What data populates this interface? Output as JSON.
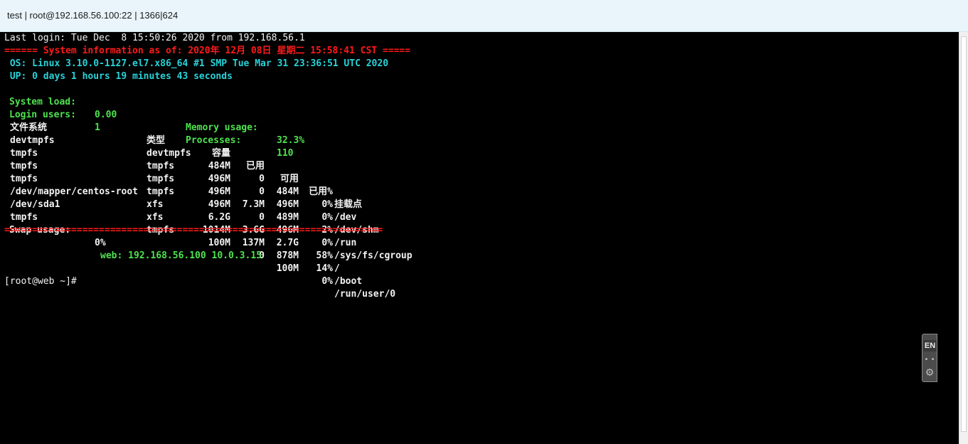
{
  "window": {
    "title": "test | root@192.168.56.100:22 | 1366|624"
  },
  "terminal": {
    "last_login": "Last login: Tue Dec  8 15:50:26 2020 from 192.168.56.1",
    "sysinfo_header": "====== System information as of: 2020年 12月 08日 星期二 15:58:41 CST =====",
    "os_line": " OS: Linux 3.10.0-1127.el7.x86_64 #1 SMP Tue Mar 31 23:36:51 UTC 2020",
    "up_line": " UP: 0 days 1 hours 19 minutes 43 seconds",
    "stats": {
      "system_load_label": "System load:",
      "system_load_value": "0.00",
      "memory_usage_label": "Memory usage:",
      "memory_usage_value": "32.3%",
      "login_users_label": "Login users:",
      "login_users_value": "1",
      "processes_label": "Processes:",
      "processes_value": "110"
    },
    "disk_headers": [
      "文件系统",
      "类型",
      "容量",
      "已用",
      "可用",
      "已用%",
      "挂载点"
    ],
    "disk_rows": [
      [
        "devtmpfs",
        "devtmpfs",
        "484M",
        "0",
        "484M",
        "0%",
        "/dev"
      ],
      [
        "tmpfs",
        "tmpfs",
        "496M",
        "0",
        "496M",
        "0%",
        "/dev/shm"
      ],
      [
        "tmpfs",
        "tmpfs",
        "496M",
        "7.3M",
        "489M",
        "2%",
        "/run"
      ],
      [
        "tmpfs",
        "tmpfs",
        "496M",
        "0",
        "496M",
        "0%",
        "/sys/fs/cgroup"
      ],
      [
        "/dev/mapper/centos-root",
        "xfs",
        "6.2G",
        "3.6G",
        "2.7G",
        "58%",
        "/"
      ],
      [
        "/dev/sda1",
        "xfs",
        "1014M",
        "137M",
        "878M",
        "14%",
        "/boot"
      ],
      [
        "tmpfs",
        "tmpfs",
        "100M",
        "0",
        "100M",
        "0%",
        "/run/user/0"
      ]
    ],
    "swap_label": "Swap usage:",
    "swap_value": "0%",
    "sysinfo_footer": "====================================================================",
    "web_line": "web: 192.168.56.100 10.0.3.15",
    "prompt": "[root@web ~]#"
  },
  "ime_indicator": {
    "label": "EN",
    "icons": [
      "dots-icon",
      "gear-icon"
    ]
  }
}
